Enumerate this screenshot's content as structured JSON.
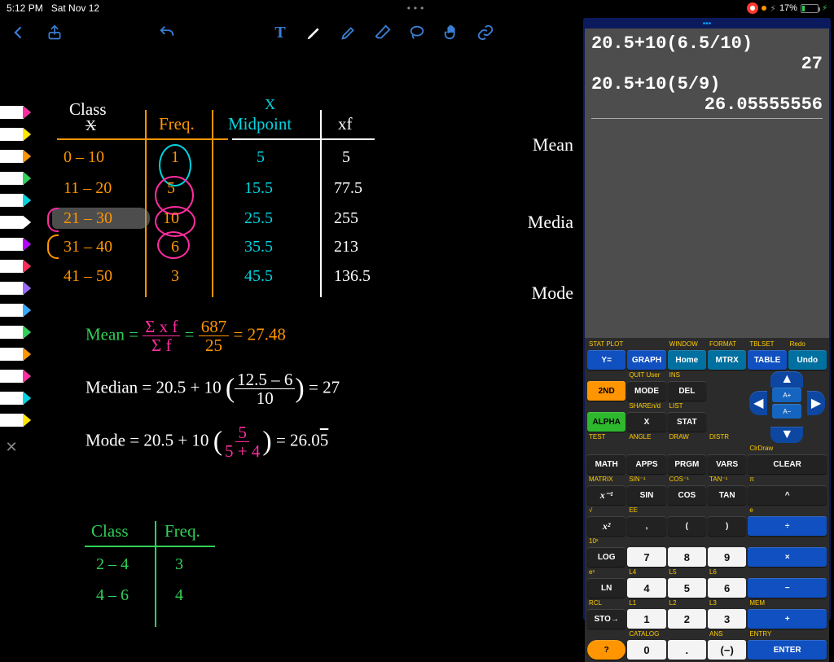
{
  "status": {
    "time": "5:12 PM",
    "date": "Sat Nov 12",
    "battery": "17%"
  },
  "toolbar": {
    "text_tool": "T"
  },
  "pens": [
    "#ff2da0",
    "#ffe600",
    "#ff9500",
    "#30d158",
    "#00d4e0",
    "#ffffff",
    "#b300ff",
    "#ff2d55",
    "#96f",
    "#3af",
    "#30d158",
    "#ff9500",
    "#ff2da0",
    "#00d4e0",
    "#ffe600"
  ],
  "table": {
    "headers": {
      "class": "Class",
      "class_x": "X",
      "freq": "Freq.",
      "x": "X",
      "mid": "Midpoint",
      "xf": "xf"
    },
    "rows": [
      {
        "class": "0 – 10",
        "freq": "1",
        "mid": "5",
        "xf": "5"
      },
      {
        "class": "11 – 20",
        "freq": "5",
        "mid": "15.5",
        "xf": "77.5"
      },
      {
        "class": "21 – 30",
        "freq": "10",
        "mid": "25.5",
        "xf": "255"
      },
      {
        "class": "31 – 40",
        "freq": "6",
        "mid": "35.5",
        "xf": "213"
      },
      {
        "class": "41 – 50",
        "freq": "3",
        "mid": "45.5",
        "xf": "136.5"
      }
    ]
  },
  "mean": {
    "label": "Mean =",
    "sigma_num": "Σ x f",
    "sigma_den": "Σ f",
    "eq": "=",
    "num": "687",
    "den": "25",
    "eq2": "= 27.48"
  },
  "median": {
    "label": "Median =",
    "expr_a": "20.5 + 10",
    "frac_num": "12.5 – 6",
    "frac_den": "10",
    "result": "= 27"
  },
  "mode": {
    "label": "Mode =",
    "expr_a": "20.5  +  10",
    "frac_num": "5",
    "frac_den": "5 + 4",
    "result": "= 26.0",
    "bar": "5"
  },
  "table2": {
    "headers": {
      "class": "Class",
      "freq": "Freq."
    },
    "rows": [
      {
        "class": "2 – 4",
        "freq": "3"
      },
      {
        "class": "4 – 6",
        "freq": "4"
      }
    ]
  },
  "side": {
    "mean": "Mean",
    "median": "Media",
    "mode": "Mode"
  },
  "calc": {
    "lines": [
      {
        "t": "20.5+10(6.5/10)",
        "a": "l"
      },
      {
        "t": "27",
        "a": "r"
      },
      {
        "t": "20.5+10(5/9)",
        "a": "l"
      },
      {
        "t": "26.05555556",
        "a": "r"
      }
    ],
    "labels_row1": [
      "STAT PLOT",
      "",
      "WINDOW",
      "FORMAT",
      "TBLSET",
      "Redo"
    ],
    "row1": [
      "Y=",
      "GRAPH",
      "Home",
      "MTRX",
      "TABLE",
      "Undo"
    ],
    "labels_row2": [
      "",
      "QUIT User",
      "INS",
      "",
      ""
    ],
    "row2": [
      "2ND",
      "MODE",
      "DEL"
    ],
    "labels_row3": [
      "",
      "SHAREn/d",
      "LIST",
      "",
      ""
    ],
    "row3": [
      "ALPHA",
      "X",
      "STAT"
    ],
    "labels_row4": [
      "TEST",
      "ANGLE",
      "DRAW",
      "DISTR",
      "ClrDraw"
    ],
    "row4": [
      "MATH",
      "APPS",
      "PRGM",
      "VARS",
      "CLEAR"
    ],
    "labels_row5": [
      "MATRIX",
      "SIN⁻¹",
      "COS⁻¹",
      "TAN⁻¹",
      "π"
    ],
    "row5": [
      "x⁻¹",
      "SIN",
      "COS",
      "TAN",
      "^"
    ],
    "labels_row6": [
      "√",
      "EE",
      "",
      "",
      "e"
    ],
    "row6": [
      "x²",
      ",",
      "(",
      ")",
      "÷"
    ],
    "labels_row7": [
      "10ˣ",
      "",
      "",
      "",
      ""
    ],
    "row7": [
      "LOG",
      "7",
      "8",
      "9",
      "×"
    ],
    "labels_row8": [
      "eˣ",
      "L4",
      "L5",
      "L6",
      ""
    ],
    "row8": [
      "LN",
      "4",
      "5",
      "6",
      "−"
    ],
    "labels_row9": [
      "RCL",
      "L1",
      "L2",
      "L3",
      "MEM"
    ],
    "row9": [
      "STO→",
      "1",
      "2",
      "3",
      "+"
    ],
    "labels_row10": [
      "",
      "CATALOG",
      "",
      "ANS",
      "ENTRY"
    ],
    "row10": [
      "?",
      "0",
      ".",
      "(−)",
      "ENTER"
    ],
    "arrows": {
      "aplus": "A+",
      "aminus": "A−"
    }
  }
}
